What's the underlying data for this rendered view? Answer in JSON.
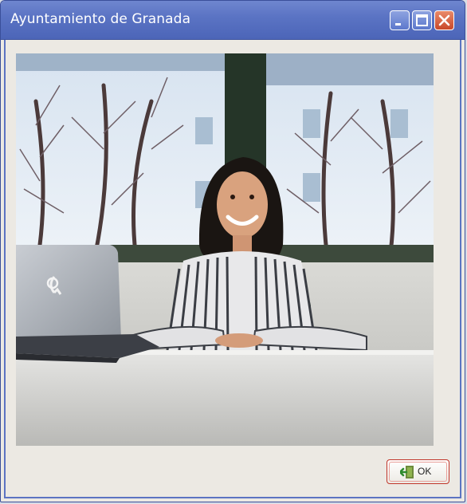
{
  "window": {
    "title": "Ayuntamiento de Granada",
    "controls": {
      "minimize": "minimize-icon",
      "maximize": "maximize-icon",
      "close": "close-icon"
    },
    "colors": {
      "titlebar": "#5b74c4",
      "body": "#ece9e3",
      "accent_red": "#c0352a"
    }
  },
  "image": {
    "subject": "woman seated at desk with laptop in office"
  },
  "buttons": {
    "ok": {
      "label": "OK",
      "icon": "exit-door-green-arrow-icon"
    }
  }
}
